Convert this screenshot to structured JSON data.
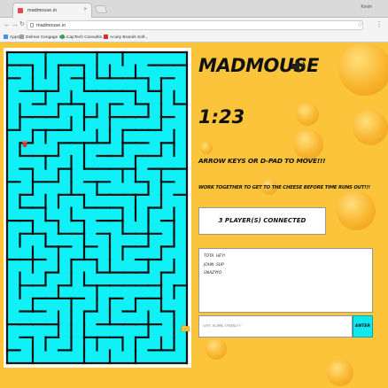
{
  "browser": {
    "tab_title": "madmouse.io",
    "tab_close": "×",
    "user_name": "Kevin",
    "back_icon": "back-arrow-icon",
    "forward_icon": "forward-arrow-icon",
    "reload_icon": "reload-icon",
    "address": "madmouse.io",
    "star": "☆",
    "menu": "⋮",
    "bookmarks": [
      {
        "label": "Apps",
        "color": "#4c8bf5"
      },
      {
        "label": "Delmar Cengage Le...",
        "color": "#9e9e9e"
      },
      {
        "label": "CapTech Consultin...",
        "color": "#3a9c47"
      },
      {
        "label": "Acuity Brands Soft...",
        "color": "#d32f2f"
      }
    ]
  },
  "game": {
    "title": "MADMOUSE",
    "sound_icon": "speaker-volume-icon",
    "timer": "1:23",
    "instructions": "ARROW KEYS OR D-PAD TO MOVE!!!",
    "goal": "WORK TOGETHER TO GET TO THE CHEESE BEFORE TIME RUNS OUT!!!",
    "players_connected": "3 PLAYER(S) CONNECTED",
    "chat_messages": [
      {
        "user": "TOTA",
        "text": "HEY!"
      },
      {
        "user": "JOHN",
        "text": "SUP"
      },
      {
        "user": "SNAZY",
        "text": "YO"
      }
    ],
    "chat_placeholder": "SAY SOMETHING!!!",
    "enter_label": "ENTER",
    "maze_color": "#10f0f7",
    "wall_color": "#111111",
    "page_color": "#fbc43a",
    "mouse_icon": "mouse-player-icon",
    "cheese_icon": "cheese-icon"
  }
}
